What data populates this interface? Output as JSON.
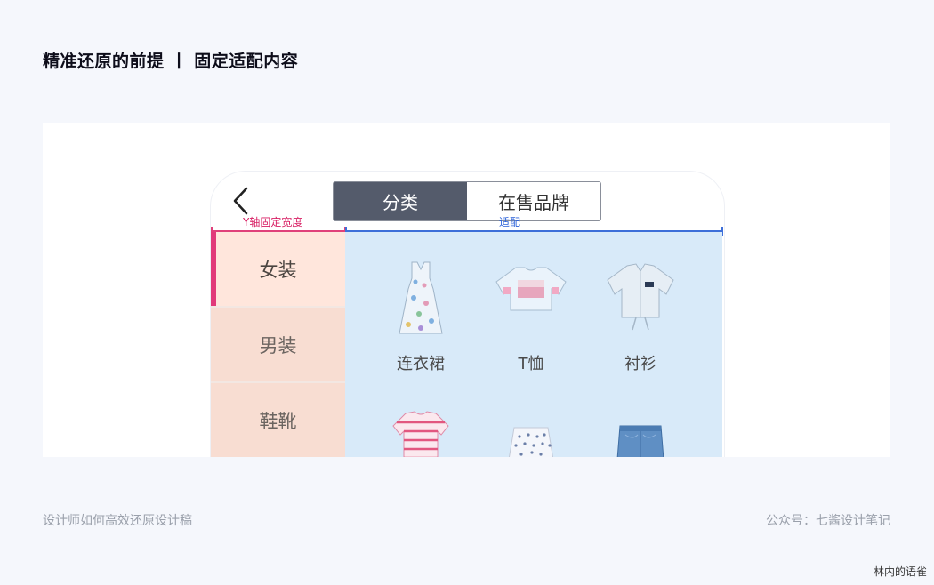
{
  "slide": {
    "title": "精准还原的前提 丨 固定适配内容"
  },
  "nav": {
    "back_icon": "chevron-left-icon",
    "tabs": [
      {
        "label": "分类",
        "active": true
      },
      {
        "label": "在售品牌",
        "active": false
      }
    ]
  },
  "annotations": {
    "fixed_width": "Y轴固定宽度",
    "adaptive": "适配",
    "fixed_color": "#e0407a",
    "adaptive_color": "#3d6fd9"
  },
  "sidebar": {
    "items": [
      {
        "label": "女装",
        "active": true
      },
      {
        "label": "男装",
        "active": false
      },
      {
        "label": "鞋靴",
        "active": false
      }
    ]
  },
  "products": {
    "items": [
      {
        "label": "连衣裙",
        "icon": "dress-icon"
      },
      {
        "label": "T恤",
        "icon": "tshirt-icon"
      },
      {
        "label": "衬衫",
        "icon": "shirt-icon"
      },
      {
        "label": "",
        "icon": "striped-top-icon"
      },
      {
        "label": "",
        "icon": "dotted-shorts-icon"
      },
      {
        "label": "",
        "icon": "denim-shorts-icon"
      }
    ]
  },
  "footer": {
    "left": "设计师如何高效还原设计稿",
    "right": "公众号：七酱设计笔记"
  },
  "watermark": "林内的语雀"
}
